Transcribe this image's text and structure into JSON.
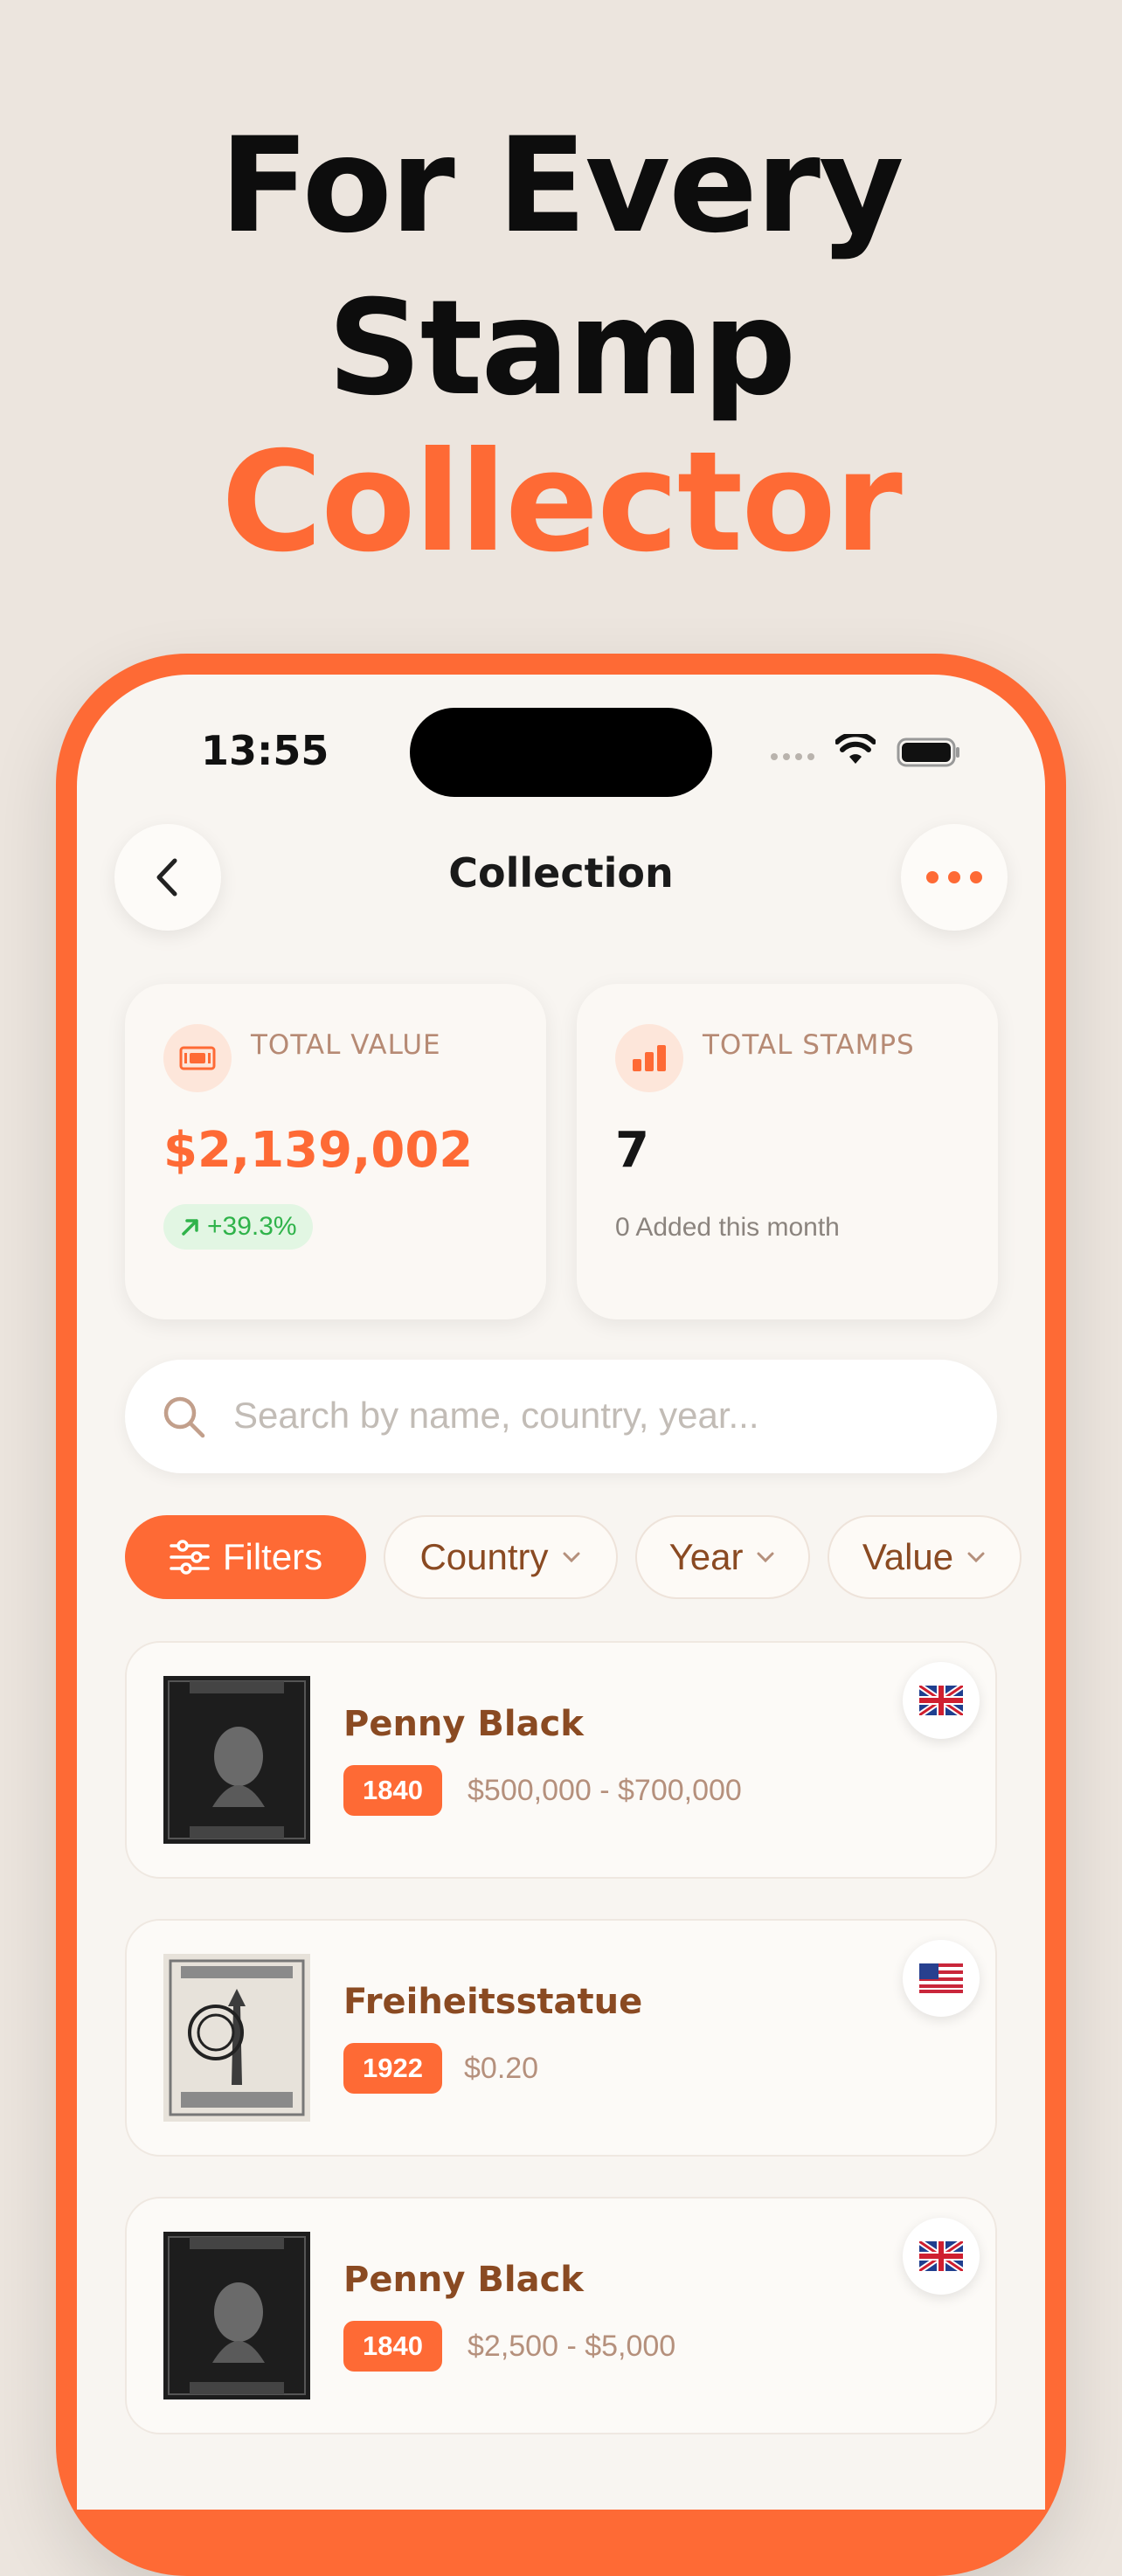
{
  "headline": {
    "line1": "For Every",
    "line2": "Stamp",
    "line3": "Collector"
  },
  "status_bar": {
    "time": "13:55"
  },
  "nav": {
    "title": "Collection"
  },
  "stats": {
    "total_value": {
      "label": "TOTAL VALUE",
      "value": "$2,139,002",
      "trend": "+39.3%"
    },
    "total_stamps": {
      "label": "TOTAL STAMPS",
      "value": "7",
      "sub": "0 Added this month"
    }
  },
  "search": {
    "placeholder": "Search by name, country, year..."
  },
  "filters": {
    "primary": "Filters",
    "chips": [
      "Country",
      "Year",
      "Value"
    ]
  },
  "stamps": [
    {
      "name": "Penny Black",
      "year": "1840",
      "price": "$500,000 - $700,000",
      "flag": "gb-flag-icon"
    },
    {
      "name": "Freiheitsstatue",
      "year": "1922",
      "price": "$0.20",
      "flag": "us-flag-icon"
    },
    {
      "name": "Penny Black",
      "year": "1840",
      "price": "$2,500 - $5,000",
      "flag": "gb-flag-icon"
    }
  ],
  "colors": {
    "accent": "#fe6a35",
    "background": "#ece5de",
    "brown_text": "#8a4a22",
    "trend_green": "#2fb34a"
  }
}
